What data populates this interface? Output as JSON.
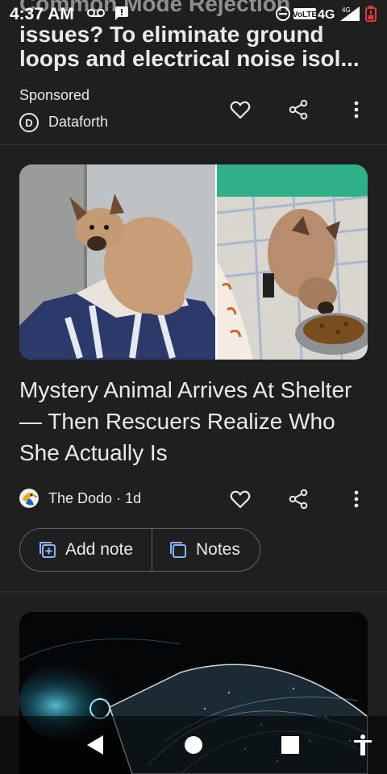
{
  "status_bar": {
    "time": "4:37 AM",
    "network": "4G",
    "icons": [
      "voicemail-icon",
      "message-icon",
      "do-not-disturb-icon",
      "volte-icon",
      "signal-icon",
      "battery-low-icon"
    ]
  },
  "ad_card": {
    "title_line_top": "Common Mode Rejection",
    "title_line_1": "issues? To eliminate ground",
    "title_line_2": "loops and electrical noise isol...",
    "sponsored_label": "Sponsored",
    "source_name": "Dataforth",
    "source_initial": "D"
  },
  "article_card": {
    "headline": "Mystery Animal Arrives At Shelter — Then Rescuers Realize Who She Actually Is",
    "source_name": "The Dodo",
    "separator": " · ",
    "age": "1d",
    "add_note_label": "Add note",
    "notes_label": "Notes"
  },
  "nav_bar": {
    "buttons": [
      "back-button",
      "home-button",
      "recents-button",
      "accessibility-button"
    ]
  },
  "colors": {
    "background": "#1f1f1f",
    "text": "#e8eaed",
    "divider": "#2d2d2f",
    "pill_border": "#5f6368",
    "battery_low": "#e53935"
  }
}
